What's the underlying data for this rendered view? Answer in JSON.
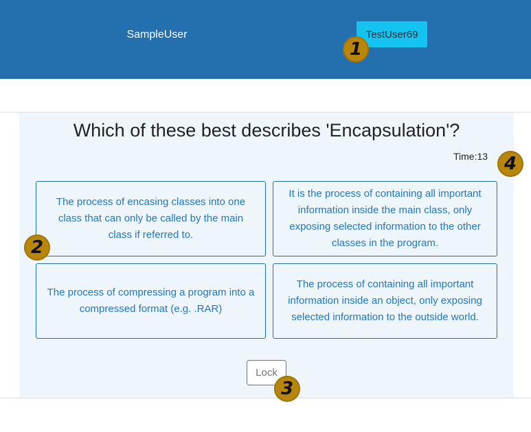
{
  "header": {
    "player_one": "SampleUser",
    "player_two": "TestUser69"
  },
  "quiz": {
    "question": "Which of these best describes 'Encapsulation'?",
    "timer": "Time:13",
    "answers": [
      "The process of encasing classes into one class that can only be called by the main class if referred to.",
      "It is the process of containing all important information inside the main class, only exposing selected information to the other classes in the program.",
      "The process of compressing a program into a compressed format (e.g. .RAR)",
      "The process of containing all important information inside an object, only exposing selected information to the outside world."
    ],
    "lock_label": "Lock"
  },
  "markers": [
    "1",
    "2",
    "3",
    "4"
  ],
  "colors": {
    "header_bg": "#2470ae",
    "active_player_bg": "#14c4f0",
    "panel_bg": "#eef6fc",
    "answer_border": "#1e6fb3",
    "answer_text": "#2277c0",
    "marker": "#b8860b"
  }
}
